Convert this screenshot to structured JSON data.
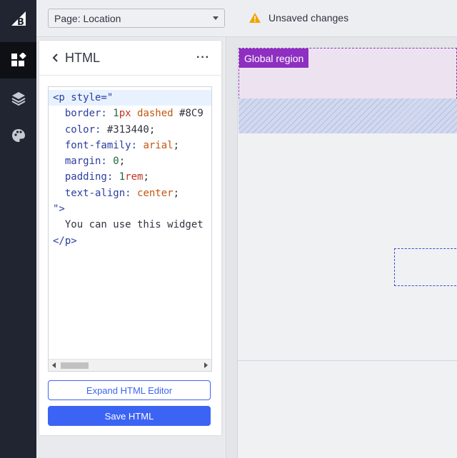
{
  "topbar": {
    "page_select": "Page: Location",
    "unsaved_label": "Unsaved changes"
  },
  "sidebar": {
    "items": [
      {
        "icon": "bigcommerce-logo-icon"
      },
      {
        "icon": "widgets-icon",
        "active": true
      },
      {
        "icon": "layers-icon"
      },
      {
        "icon": "palette-icon"
      }
    ]
  },
  "panel": {
    "title": "HTML",
    "more": "···",
    "code": {
      "line1_open": "<p",
      "line1_attr": " style=\"",
      "border_prop": "  border: ",
      "border_num": "1",
      "border_unit": "px",
      "border_val": " dashed",
      "border_color": " #8C9",
      "color_prop": "  color: ",
      "color_val": "#313440;",
      "font_prop": "  font-family: ",
      "font_val": "arial",
      "margin_prop": "  margin: ",
      "margin_num": "0",
      "padding_prop": "  padding: ",
      "padding_num": "1",
      "padding_unit": "rem",
      "align_prop": "  text-align: ",
      "align_val": "center",
      "close_attr": "\">",
      "content": "  You can use this widget",
      "close_tag": "</p>"
    },
    "expand_button": "Expand HTML Editor",
    "save_button": "Save HTML"
  },
  "canvas": {
    "global_region_label": "Global region"
  },
  "colors": {
    "accent": "#3c64f4",
    "sidebar_bg": "#202531",
    "region_purple": "#8e2fc1",
    "warning": "#f2a300"
  }
}
